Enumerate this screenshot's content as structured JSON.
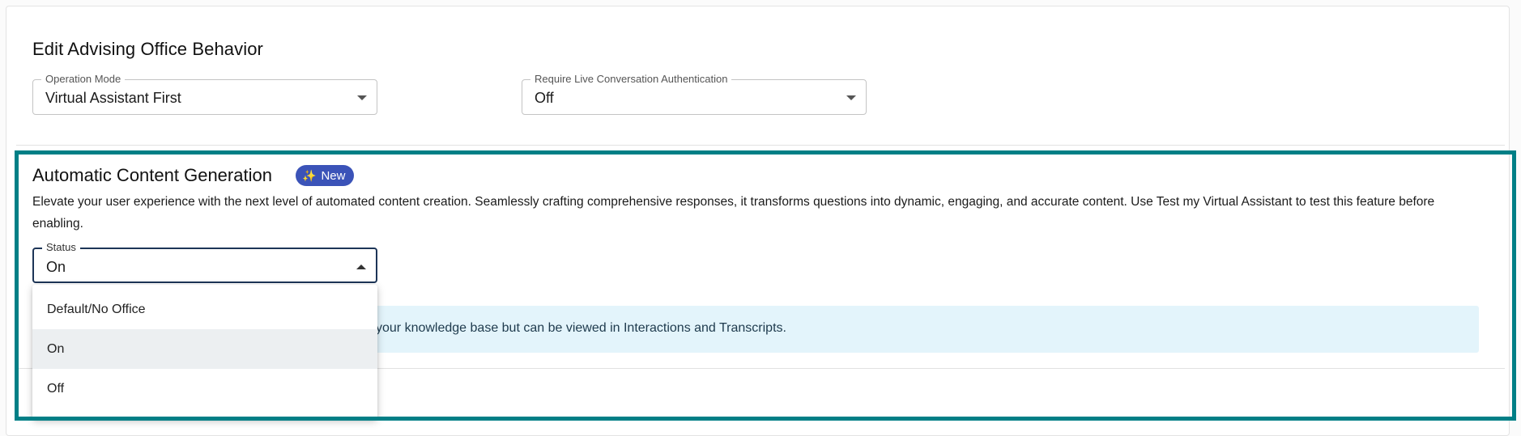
{
  "behavior": {
    "title": "Edit Advising Office Behavior",
    "operation_mode": {
      "label": "Operation Mode",
      "value": "Virtual Assistant First"
    },
    "require_auth": {
      "label": "Require Live Conversation Authentication",
      "value": "Off"
    }
  },
  "content_generation": {
    "title": "Automatic Content Generation",
    "badge": {
      "label": "New",
      "icon": "sparkles-icon"
    },
    "description": "Elevate your user experience with the next level of automated content creation. Seamlessly crafting comprehensive responses, it transforms questions into dynamic, engaging, and accurate content. Use Test my Virtual Assistant to test this feature before enabling.",
    "status": {
      "label": "Status",
      "value": "On",
      "options": [
        "Default/No Office",
        "On",
        "Off"
      ],
      "selected_option": "On"
    },
    "info_text": "your knowledge base but can be viewed in Interactions and Transcripts."
  },
  "colors": {
    "highlight_border": "#007f86",
    "badge_bg": "#3b53b8",
    "info_bg": "#e3f4fb",
    "selected_option_bg": "#eceff1"
  }
}
